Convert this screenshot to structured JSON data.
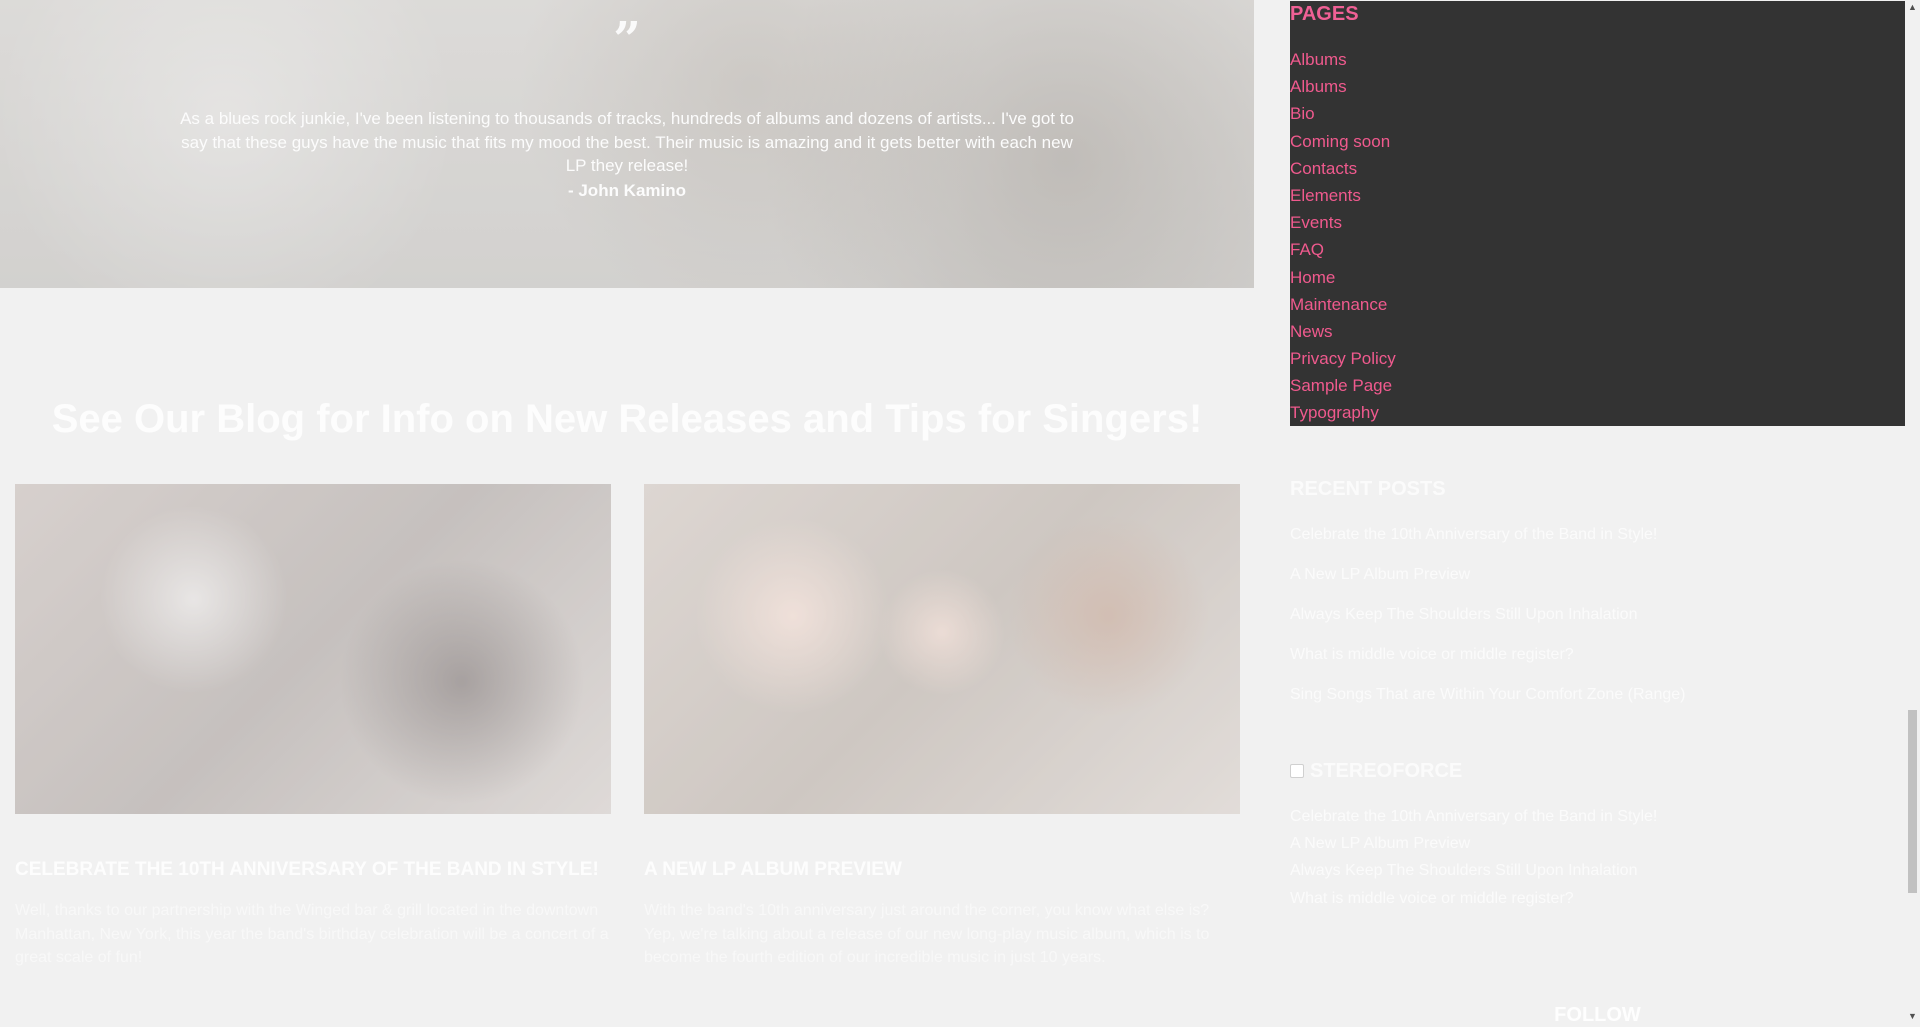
{
  "testimonial": {
    "quote_mark": "”",
    "text": "As a blues rock junkie, I've been listening to thousands of tracks, hundreds of albums and dozens of artists... I've got to say that these guys have the music that fits my mood the best. Their music is amazing and it gets better with each new LP they release!",
    "author": "- John Kamino"
  },
  "blog": {
    "heading": "See Our Blog for Info on New Releases and Tips for Singers!",
    "posts": [
      {
        "title": "CELEBRATE THE 10TH ANNIVERSARY OF THE BAND IN STYLE!",
        "excerpt": "Well, thanks to our partnership with the Winged bar & grill located in the downtown Manhattan, New York, this year the band's birthday celebration will be a concert of a great scale of fun!"
      },
      {
        "title": "A NEW LP ALBUM PREVIEW",
        "excerpt": "With the band's 10th anniversary just around the corner, you know what else is? Yep, we're talking about a release of our new long-play music album, which is to become the fourth edition of our incredible music in just 10 years."
      }
    ]
  },
  "sidebar": {
    "pages": {
      "title": "PAGES",
      "items": [
        "Albums",
        "Albums",
        "Bio",
        "Coming soon",
        "Contacts",
        "Elements",
        "Events",
        "FAQ",
        "Home",
        "Maintenance",
        "News",
        "Privacy Policy",
        "Sample Page",
        "Typography"
      ]
    },
    "recent_posts": {
      "title": "RECENT POSTS",
      "items": [
        "Celebrate the 10th Anniversary of the Band in Style!",
        "A New LP Album Preview",
        "Always Keep The Shoulders Still Upon Inhalation",
        "What is middle voice or middle register?",
        "Sing Songs That are Within Your Comfort Zone (Range)"
      ]
    },
    "rss": {
      "title": "STEREOFORCE",
      "icon": "rss-icon",
      "items": [
        "Celebrate the 10th Anniversary of the Band in Style!",
        "A New LP Album Preview",
        "Always Keep The Shoulders Still Upon Inhalation",
        "What is middle voice or middle register?"
      ]
    },
    "follow": {
      "title": "FOLLOW"
    }
  },
  "scrollbar": {
    "up": "▲",
    "down": "▼"
  },
  "colors": {
    "accent": "#f05a8e",
    "panel": "#333333",
    "background": "#f1f1f1"
  }
}
